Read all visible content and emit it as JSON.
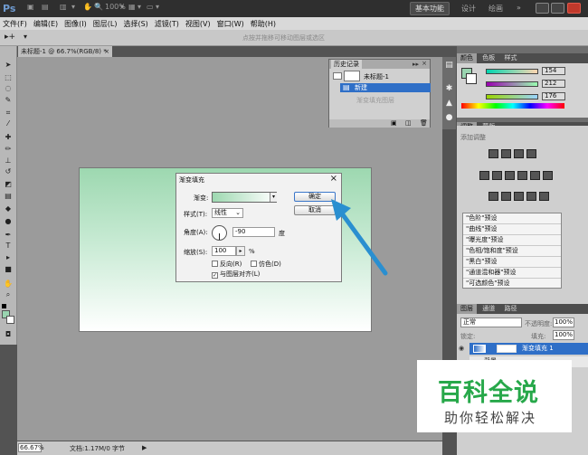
{
  "app": {
    "logo": "Ps",
    "workspace_active": "基本功能",
    "workspaces": [
      "设计",
      "绘画"
    ],
    "more": "»"
  },
  "topbar": {
    "zoom": "100%",
    "zoom_arrow": "▾",
    "arrange_arrow": "▾",
    "screen_arrow": "▾"
  },
  "menu": [
    "文件(F)",
    "编辑(E)",
    "图像(I)",
    "图层(L)",
    "选择(S)",
    "滤镜(T)",
    "视图(V)",
    "窗口(W)",
    "帮助(H)"
  ],
  "options_bar": {
    "tool_glyph": "▸+",
    "hint": "点按并拖移可移动图层或选区"
  },
  "document": {
    "tab_label": "未标题-1 @ 66.7%(RGB/8) *",
    "close": "×"
  },
  "status_bar": {
    "zoom": "66.67%",
    "info": "文档:1.17M/0 字节",
    "arrow": "▶"
  },
  "dialog": {
    "title": "渐变填充",
    "close": "×",
    "gradient_label": "渐变:",
    "ok_label": "确定",
    "cancel_label": "取消",
    "style_label": "样式(T):",
    "style_value": "线性",
    "angle_label": "角度(A):",
    "angle_value": "-90",
    "angle_unit": "度",
    "scale_label": "缩放(S):",
    "scale_value": "100",
    "scale_unit": "%",
    "reverse_label": "反向(R)",
    "dither_label": "仿色(D)",
    "align_label": "与图层对齐(L)"
  },
  "history_panel": {
    "tab": "历史记录",
    "snapshot": "未标题-1",
    "step_new": "新建",
    "step_faded": "渐变填充图层"
  },
  "color_panel": {
    "tabs": [
      "颜色",
      "色板",
      "样式"
    ],
    "r": "154",
    "g": "212",
    "b": "176",
    "fg_color": "#9ad4b0"
  },
  "adjust_panel": {
    "tabs": [
      "调整",
      "蒙版"
    ],
    "subtitle": "添加调整",
    "presets": [
      "\"色阶\"预设",
      "\"曲线\"预设",
      "\"曝光度\"预设",
      "\"色相/饱和度\"预设",
      "\"黑白\"预设",
      "\"通道混和器\"预设",
      "\"可选颜色\"预设"
    ]
  },
  "layers_panel": {
    "tabs": [
      "图层",
      "通道",
      "路径"
    ],
    "blend_mode": "正常",
    "opacity_label": "不透明度:",
    "opacity": "100%",
    "lock_label": "锁定:",
    "fill_label": "填充:",
    "fill": "100%",
    "selected_layer": "渐变填充 1",
    "background_layer": "背景"
  },
  "watermark": {
    "title": "百科全说",
    "subtitle": "助你轻松解决"
  },
  "colors": {
    "accent_blue": "#2f6fc7",
    "arrow_blue": "#2a8fd0",
    "gradient_green": "#9dd8b0",
    "watermark_green": "#27a84a"
  }
}
